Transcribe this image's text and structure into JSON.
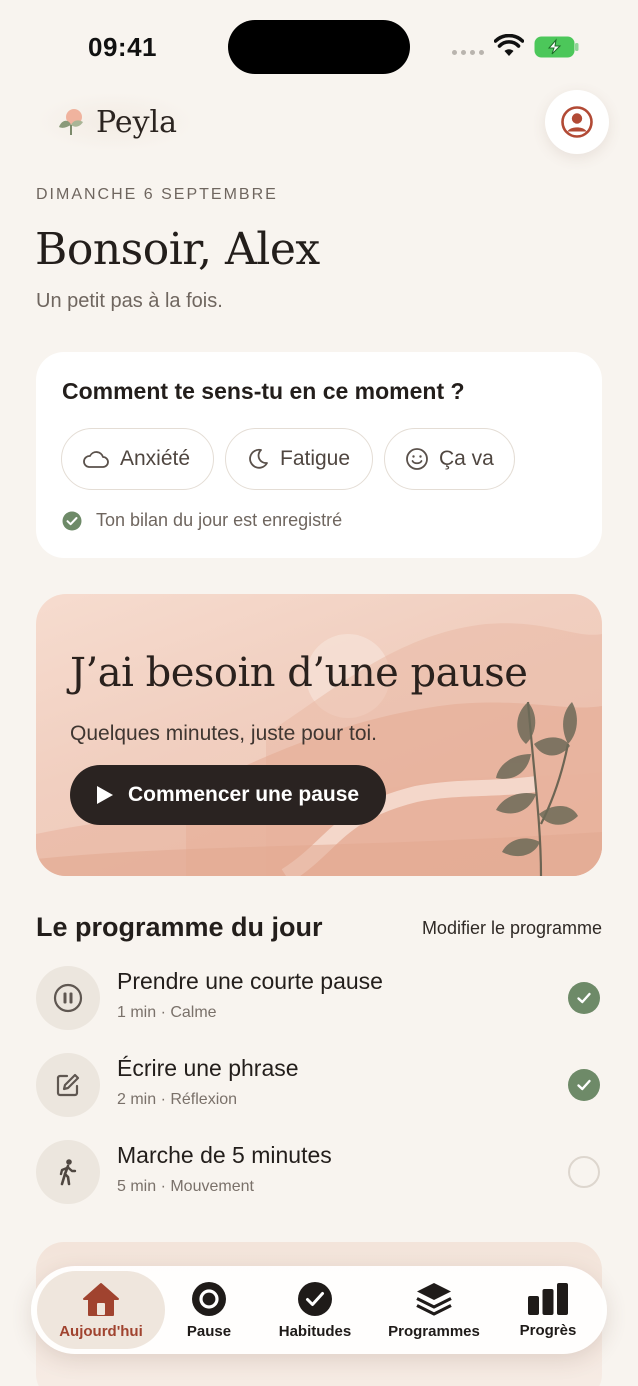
{
  "status_bar": {
    "time": "09:41"
  },
  "brand": {
    "name": "Peyla"
  },
  "header": {
    "date": "DIMANCHE 6 SEPTEMBRE",
    "greeting": "Bonsoir, Alex",
    "subtitle": "Un petit pas à la fois."
  },
  "mood": {
    "question": "Comment te sens-tu en ce moment ?",
    "options": [
      {
        "label": "Anxiété",
        "icon": "cloud-icon"
      },
      {
        "label": "Fatigue",
        "icon": "moon-icon"
      },
      {
        "label": "Ça va",
        "icon": "smile-icon"
      }
    ],
    "saved_text": "Ton bilan du jour est enregistré"
  },
  "pause_card": {
    "title": "J’ai besoin d’une pause",
    "subtitle": "Quelques minutes, juste pour toi.",
    "button_label": "Commencer une pause"
  },
  "program": {
    "title": "Le programme du jour",
    "edit_label": "Modifier le programme",
    "tasks": [
      {
        "name": "Prendre une courte pause",
        "meta": "1 min · Calme",
        "icon": "pause-icon",
        "done": true
      },
      {
        "name": "Écrire une phrase",
        "meta": "2 min · Réflexion",
        "icon": "edit-icon",
        "done": true
      },
      {
        "name": "Marche de 5 minutes",
        "meta": "5 min · Mouvement",
        "icon": "walk-icon",
        "done": false
      }
    ]
  },
  "tabs": [
    {
      "label": "Aujourd'hui",
      "icon": "home-icon",
      "active": true
    },
    {
      "label": "Pause",
      "icon": "circle-icon",
      "active": false
    },
    {
      "label": "Habitudes",
      "icon": "check-circle-icon",
      "active": false
    },
    {
      "label": "Programmes",
      "icon": "layers-icon",
      "active": false
    },
    {
      "label": "Progrès",
      "icon": "bar-chart-icon",
      "active": false
    }
  ],
  "colors": {
    "background": "#f8f4ef",
    "accent": "#a0432f",
    "success": "#6e8a68",
    "dark_button": "#2a2321"
  }
}
